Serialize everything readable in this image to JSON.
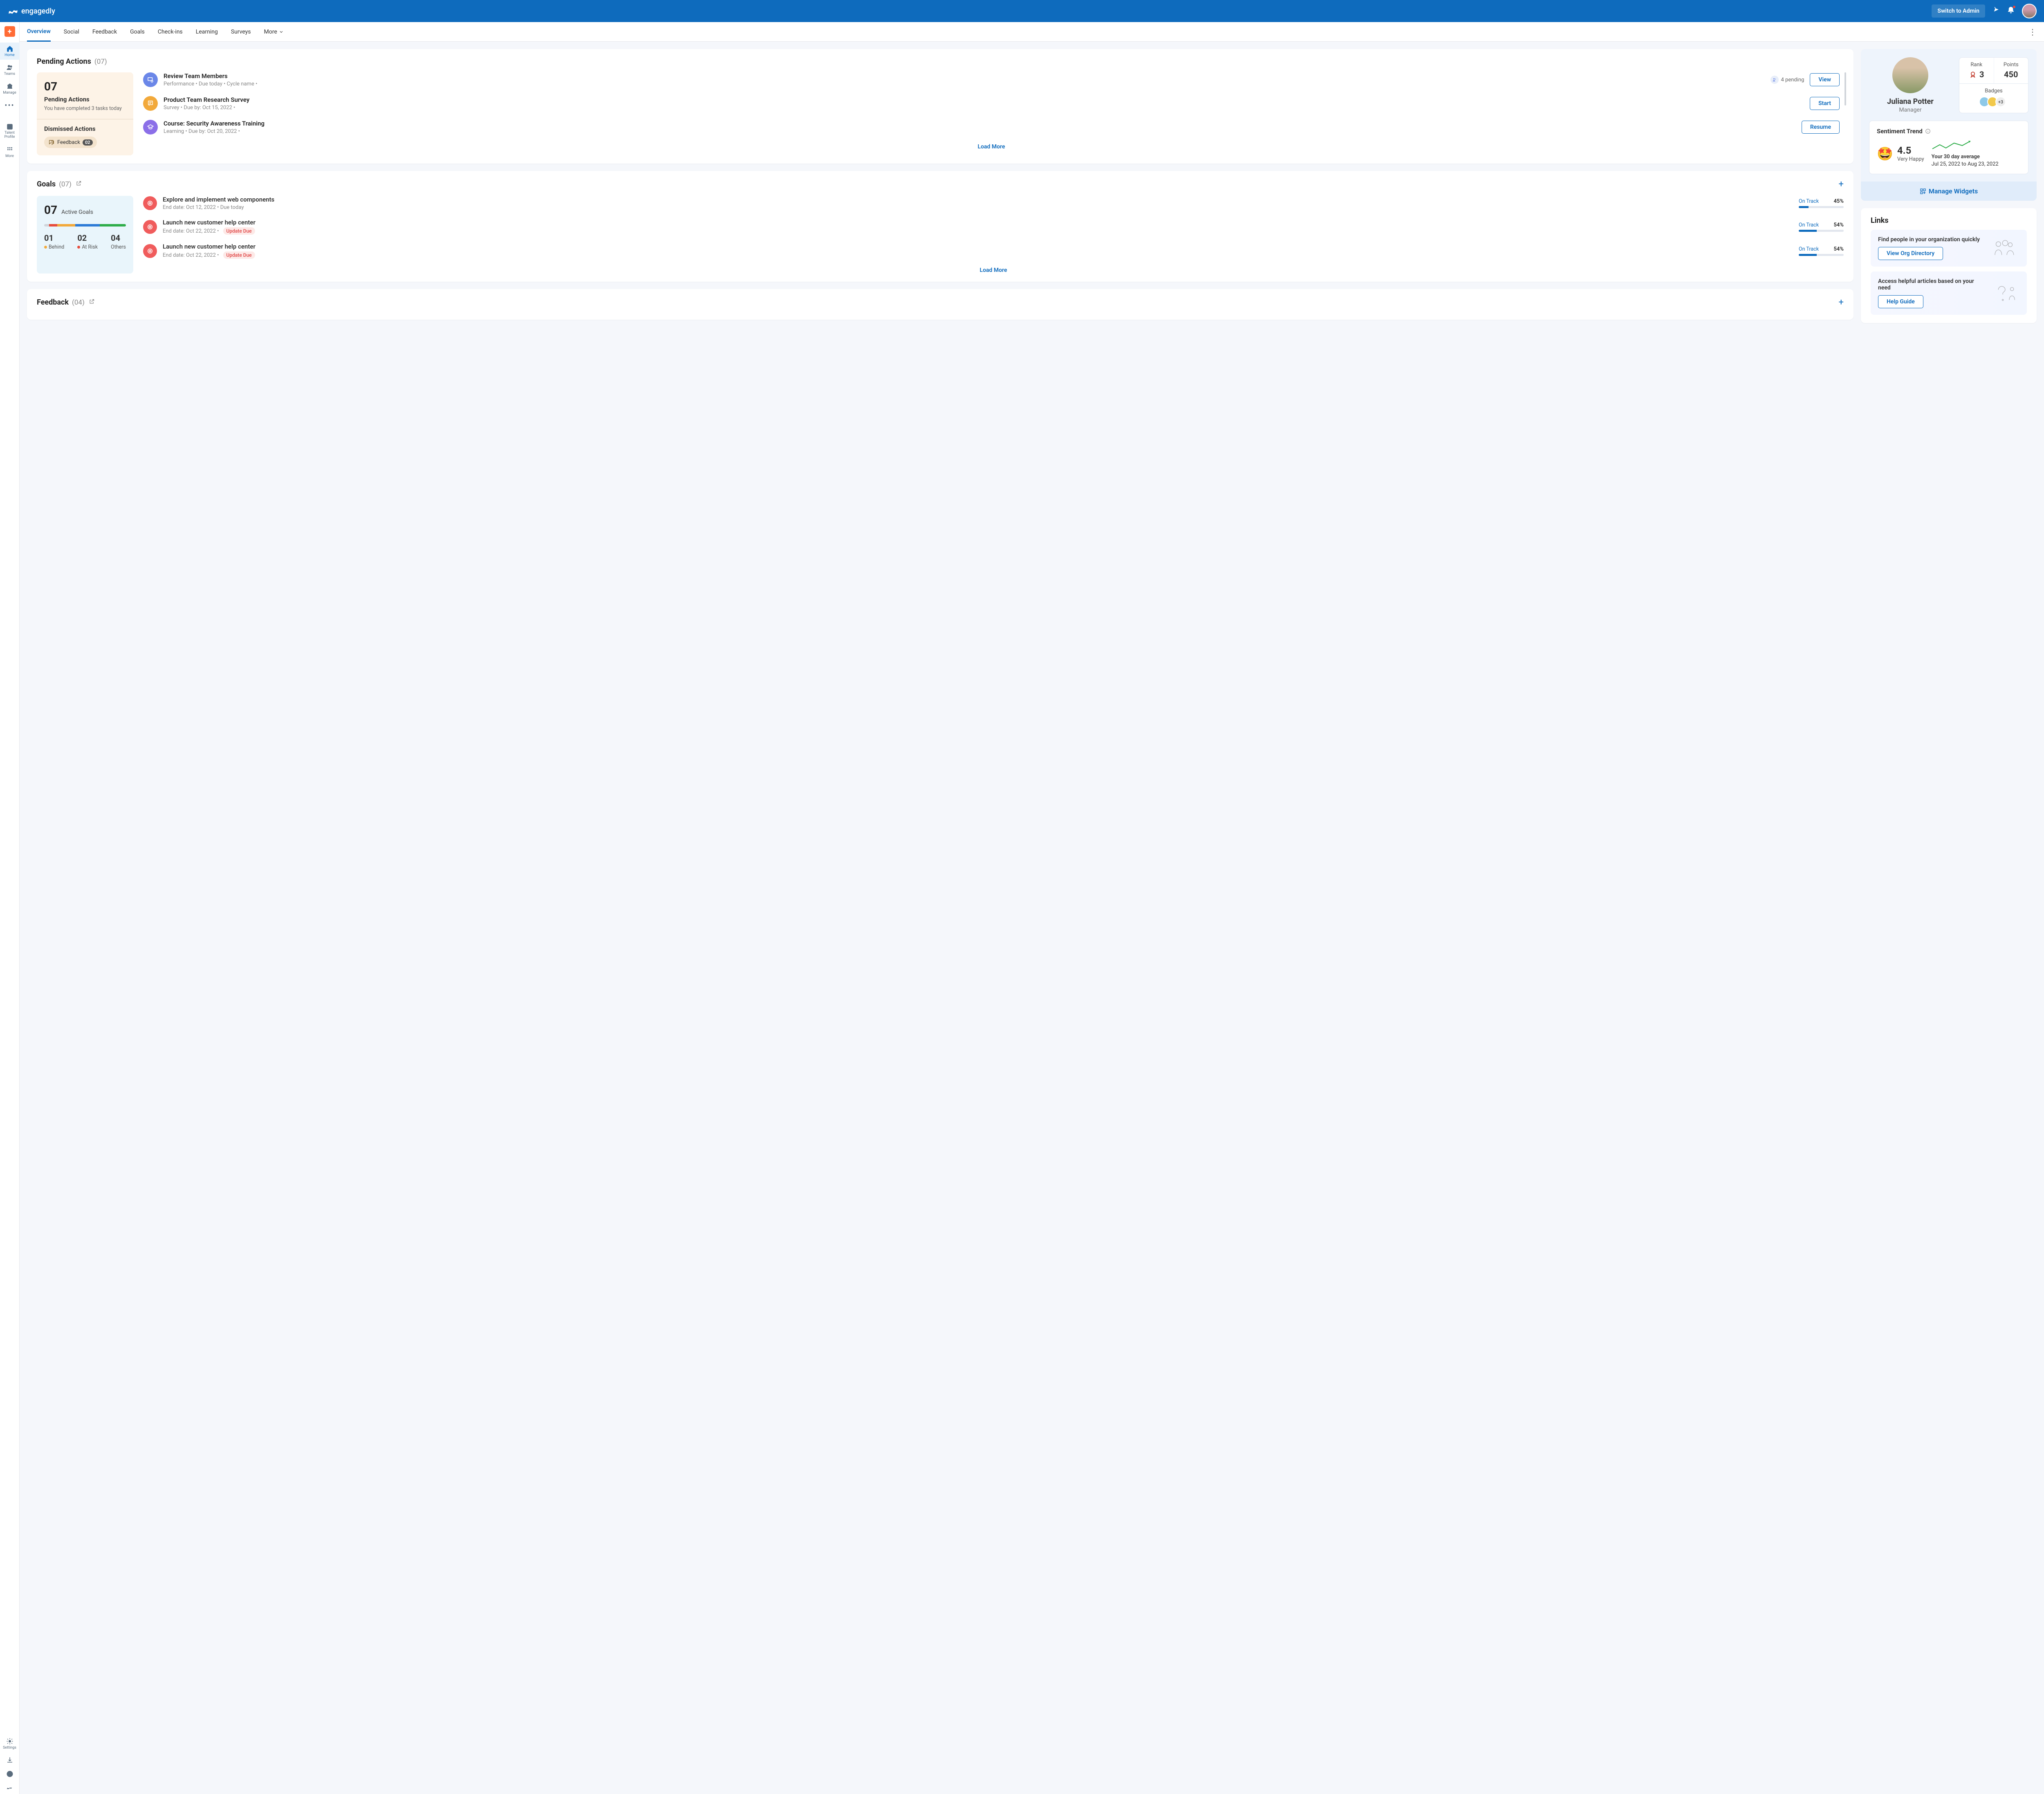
{
  "app": {
    "name": "engagedly",
    "admin_btn": "Switch to Admin"
  },
  "tabs": [
    "Overview",
    "Social",
    "Feedback",
    "Goals",
    "Check-ins",
    "Learning",
    "Surveys",
    "More"
  ],
  "rail": {
    "home": "Home",
    "teams": "Teams",
    "manage": "Manage",
    "more": "More",
    "talent": "Talent Profile",
    "more2": "More",
    "settings": "Settings"
  },
  "pending": {
    "title": "Pending Actions",
    "count": "(07)",
    "summary_num": "07",
    "summary_label": "Pending Actions",
    "summary_sub": "You have completed 3 tasks today",
    "dismissed_title": "Dismissed Actions",
    "chip_label": "Feedback",
    "chip_badge": "02",
    "items": [
      {
        "title": "Review Team Members",
        "meta": "Performance  •  Due today  •  Cycle name  •",
        "pending": "4 pending",
        "action": "View",
        "color": "#6b87e8"
      },
      {
        "title": "Product Team Research Survey",
        "meta": "Survey  •  Due by: Oct 15, 2022  •",
        "action": "Start",
        "color": "#f2a93b"
      },
      {
        "title": "Course: Security Awareness Training",
        "meta": "Learning  •  Due by: Oct 20, 2022    •",
        "action": "Resume",
        "color": "#8b6fe8"
      }
    ],
    "load_more": "Load More"
  },
  "goals": {
    "title": "Goals",
    "count": "(07)",
    "active_num": "07",
    "active_label": "Active Goals",
    "seg": [
      {
        "c": "#d0d4da",
        "w": 6
      },
      {
        "c": "#e74c3c",
        "w": 10
      },
      {
        "c": "#f2a93b",
        "w": 22
      },
      {
        "c": "#2d7bd6",
        "w": 30
      },
      {
        "c": "#2fad4a",
        "w": 32
      }
    ],
    "stats": [
      {
        "num": "01",
        "label": "Behind",
        "dot": "#f2a93b"
      },
      {
        "num": "02",
        "label": "At Risk",
        "dot": "#e74c3c"
      },
      {
        "num": "04",
        "label": "Others",
        "dot": ""
      }
    ],
    "items": [
      {
        "title": "Explore and implement web components",
        "meta": "End date: Oct 12, 2022  •  Due today",
        "status": "On Track",
        "pct": "45%",
        "bar": 22
      },
      {
        "title": "Launch new customer help center",
        "meta": "End date: Oct 22, 2022  •",
        "update_due": "Update Due",
        "status": "On Track",
        "pct": "54%",
        "bar": 40
      },
      {
        "title": "Launch new customer help center",
        "meta": "End date: Oct 22, 2022  •",
        "update_due": "Update Due",
        "status": "On Track",
        "pct": "54%",
        "bar": 40
      }
    ],
    "load_more": "Load More"
  },
  "feedback": {
    "title": "Feedback",
    "count": "(04)"
  },
  "profile": {
    "name": "Juliana Potter",
    "role": "Manager",
    "rank_lbl": "Rank",
    "rank": "3",
    "points_lbl": "Points",
    "points": "450",
    "badges_lbl": "Badges",
    "badges_more": "+3"
  },
  "sentiment": {
    "title": "Sentiment Trend",
    "score": "4.5",
    "label": "Very Happy",
    "avg_title": "Your 30 day average",
    "avg_range": "Jul 25, 2022 to Aug 23, 2022"
  },
  "manage_widgets": "Manage Widgets",
  "links": {
    "title": "Links",
    "box1_text": "Find people in your organization quickly",
    "box1_btn": "View Org Directory",
    "box2_text": "Access helpful articles based on your need",
    "box2_btn": "Help Guide"
  }
}
